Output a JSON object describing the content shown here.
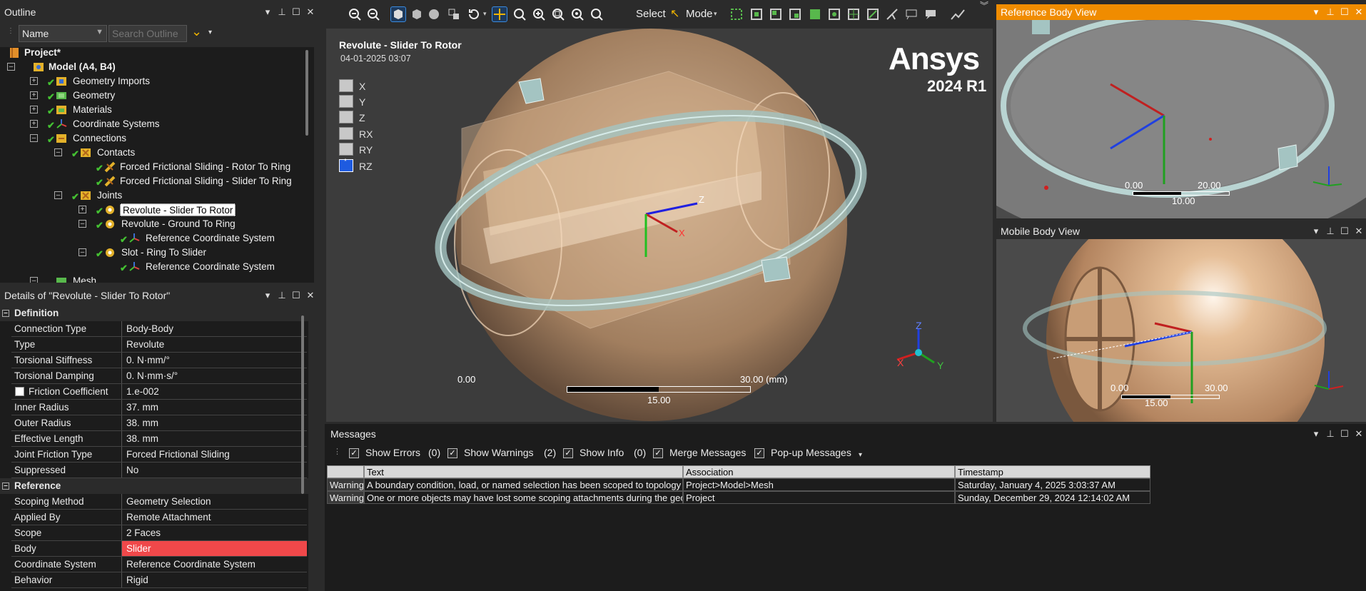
{
  "outline": {
    "title": "Outline",
    "filter_name": "Name",
    "search_placeholder": "Search Outline",
    "items": [
      {
        "label": "Project*"
      },
      {
        "label": "Model (A4, B4)"
      },
      {
        "label": "Geometry Imports"
      },
      {
        "label": "Geometry"
      },
      {
        "label": "Materials"
      },
      {
        "label": "Coordinate Systems"
      },
      {
        "label": "Connections"
      },
      {
        "label": "Contacts"
      },
      {
        "label": "Forced Frictional Sliding - Rotor To Ring"
      },
      {
        "label": "Forced Frictional Sliding - Slider To Ring"
      },
      {
        "label": "Joints"
      },
      {
        "label": "Revolute - Slider To Rotor"
      },
      {
        "label": "Revolute - Ground To Ring"
      },
      {
        "label": "Reference Coordinate System"
      },
      {
        "label": "Slot - Ring To Slider"
      },
      {
        "label": "Reference Coordinate System"
      },
      {
        "label": "Mesh"
      }
    ]
  },
  "details": {
    "title": "Details of \"Revolute - Slider To Rotor\"",
    "sections": {
      "definition": "Definition",
      "reference": "Reference"
    },
    "rows": [
      {
        "k": "Connection Type",
        "v": "Body-Body"
      },
      {
        "k": "Type",
        "v": "Revolute"
      },
      {
        "k": "Torsional Stiffness",
        "v": "0. N·mm/°"
      },
      {
        "k": "Torsional Damping",
        "v": "0. N·mm·s/°"
      },
      {
        "k": "Friction Coefficient",
        "v": "1.e-002"
      },
      {
        "k": "Inner Radius",
        "v": "37. mm"
      },
      {
        "k": "Outer Radius",
        "v": "38. mm"
      },
      {
        "k": "Effective Length",
        "v": "38. mm"
      },
      {
        "k": "Joint Friction Type",
        "v": "Forced Frictional Sliding"
      },
      {
        "k": "Suppressed",
        "v": "No"
      },
      {
        "k": "Scoping Method",
        "v": "Geometry Selection"
      },
      {
        "k": "Applied By",
        "v": "Remote Attachment"
      },
      {
        "k": "Scope",
        "v": "2 Faces"
      },
      {
        "k": "Body",
        "v": "Slider"
      },
      {
        "k": "Coordinate System",
        "v": "Reference Coordinate System"
      },
      {
        "k": "Behavior",
        "v": "Rigid"
      }
    ]
  },
  "toolbar": {
    "select_label": "Select",
    "mode_label": "Mode"
  },
  "viewport": {
    "title": "Revolute - Slider To Rotor",
    "date": "04-01-2025 03:07",
    "logo_text": "Ansys",
    "version": "2024 R1",
    "dofs": [
      "X",
      "Y",
      "Z",
      "RX",
      "RY",
      "RZ"
    ],
    "scale_min": "0.00",
    "scale_max": "30.00 (mm)",
    "scale_mid": "15.00",
    "axis_z": "Z",
    "axis_x": "X",
    "axis_y": "Y"
  },
  "ref_view": {
    "title": "Reference Body View",
    "scale_min": "0.00",
    "scale_max": "20.00",
    "scale_mid": "10.00"
  },
  "mob_view": {
    "title": "Mobile Body View",
    "scale_min": "0.00",
    "scale_max": "30.00",
    "scale_mid": "15.00"
  },
  "messages": {
    "title": "Messages",
    "filters": [
      {
        "label": "Show Errors",
        "count": "(0)"
      },
      {
        "label": "Show Warnings",
        "count": "(2)"
      },
      {
        "label": "Show Info",
        "count": "(0)"
      },
      {
        "label": "Merge Messages",
        "count": ""
      },
      {
        "label": "Pop-up Messages",
        "count": ""
      }
    ],
    "columns": [
      "Text",
      "Association",
      "Timestamp"
    ],
    "rows": [
      {
        "type": "Warning",
        "text": "A boundary condition, load, or named selection has been scoped to topology that is not",
        "assoc": "Project>Model>Mesh",
        "time": "Saturday, January 4, 2025 3:03:37 AM"
      },
      {
        "type": "Warning",
        "text": "One or more objects may have lost some scoping attachments during the geometry updat",
        "assoc": "Project",
        "time": "Sunday, December 29, 2024 12:14:02 AM"
      }
    ]
  },
  "colors": {
    "accent": "#f08c00",
    "highlight_body": "#f0484a",
    "check": "#44c032"
  }
}
